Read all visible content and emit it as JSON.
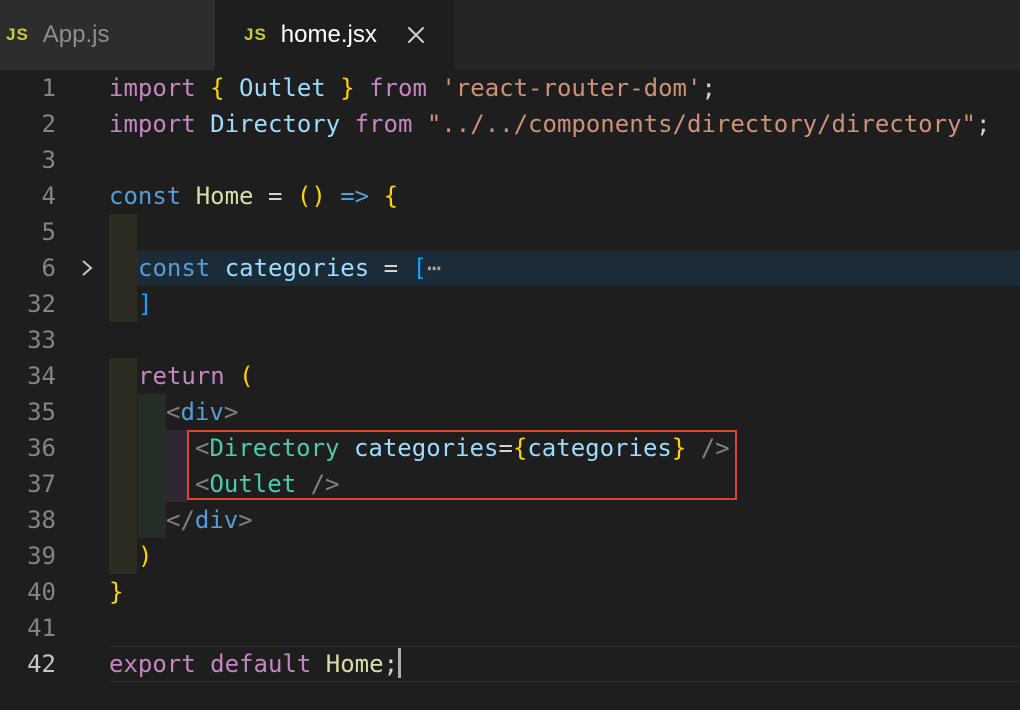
{
  "tabs": [
    {
      "badge": "JS",
      "label": "App.js",
      "active": false
    },
    {
      "badge": "JS",
      "label": "home.jsx",
      "active": true,
      "close_icon": "close-icon"
    }
  ],
  "editor": {
    "line_numbers": [
      "1",
      "2",
      "3",
      "4",
      "5",
      "6",
      "32",
      "33",
      "34",
      "35",
      "36",
      "37",
      "38",
      "39",
      "40",
      "41",
      "42"
    ],
    "folded_region": {
      "start_line": "6",
      "fold_icon": "chevron-right-icon",
      "placeholder": "⋯"
    },
    "current_line": "42",
    "code": {
      "l1": [
        "import",
        " ",
        "{",
        " Outlet ",
        "}",
        " from ",
        "'react-router-dom'",
        ";"
      ],
      "l2": [
        "import",
        " Directory ",
        "from",
        " ",
        "\"../../components/directory/directory\"",
        ";"
      ],
      "l4": [
        "const",
        " ",
        "Home",
        " = ",
        "(",
        ")",
        " ",
        "=>",
        " ",
        "{"
      ],
      "l6": [
        "const",
        " ",
        "categories",
        " = ",
        "[",
        "⋯"
      ],
      "l32": [
        "]"
      ],
      "l34": [
        "return",
        " ",
        "("
      ],
      "l35": [
        "<",
        "div",
        ">"
      ],
      "l36": [
        "<",
        "Directory",
        " ",
        "categories",
        "=",
        "{",
        "categories",
        "}",
        " ",
        "/>"
      ],
      "l37": [
        "<",
        "Outlet",
        " ",
        "/>"
      ],
      "l38": [
        "</",
        "div",
        ">"
      ],
      "l39": [
        ")"
      ],
      "l40": [
        "}"
      ],
      "l42": [
        "export",
        " ",
        "default",
        " ",
        "Home",
        ";"
      ]
    },
    "annotation": {
      "color": "#e0452f",
      "lines": [
        "36",
        "37"
      ]
    }
  },
  "colors": {
    "background": "#1e1e1e",
    "tabbar": "#252526",
    "keyword": "#c586c0",
    "declaration": "#569cd6",
    "tag": "#4ec9b0",
    "variable": "#9cdcfe",
    "function": "#dcdcaa",
    "string": "#ce9178",
    "bracket_yellow": "#ffd700",
    "bracket_magenta": "#da70d6",
    "bracket_blue": "#179fff"
  }
}
